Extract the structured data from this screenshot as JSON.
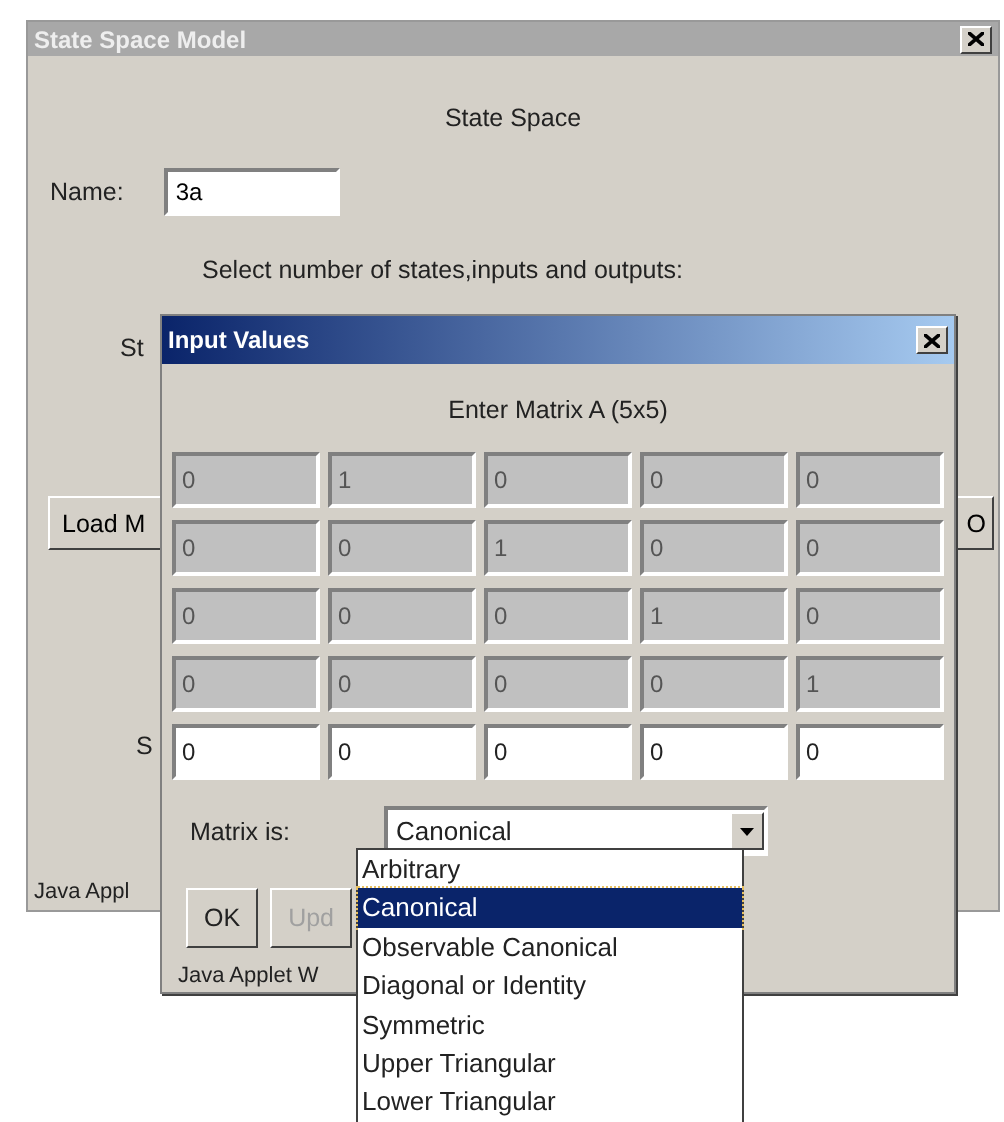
{
  "window": {
    "title": "State Space Model",
    "heading": "State Space",
    "name_label": "Name:",
    "name_value": "3a",
    "prompt": "Select number of states,inputs and outputs:",
    "partial_label_1": "St",
    "load_button": "Load M",
    "right_button": "O",
    "partial_label_2": "S",
    "status": "Java Appl"
  },
  "dialog": {
    "title": "Input Values",
    "heading": "Enter Matrix A (5x5)",
    "rows": [
      {
        "editable": false,
        "cells": [
          "0",
          "1",
          "0",
          "0",
          "0"
        ]
      },
      {
        "editable": false,
        "cells": [
          "0",
          "0",
          "1",
          "0",
          "0"
        ]
      },
      {
        "editable": false,
        "cells": [
          "0",
          "0",
          "0",
          "1",
          "0"
        ]
      },
      {
        "editable": false,
        "cells": [
          "0",
          "0",
          "0",
          "0",
          "1"
        ]
      },
      {
        "editable": true,
        "cells": [
          "0",
          "0",
          "0",
          "0",
          "0"
        ]
      }
    ],
    "matrix_label": "Matrix is:",
    "matrix_value": "Canonical",
    "buttons": [
      {
        "label": "OK",
        "disabled": false
      },
      {
        "label": "Upd",
        "disabled": true
      }
    ],
    "status": "Java Applet W",
    "options": [
      {
        "label": "Arbitrary",
        "selected": false
      },
      {
        "label": "Canonical",
        "selected": true
      },
      {
        "label": "Observable Canonical",
        "selected": false
      },
      {
        "label": "Diagonal or Identity",
        "selected": false
      },
      {
        "label": "Symmetric",
        "selected": false
      },
      {
        "label": "Upper Triangular",
        "selected": false
      },
      {
        "label": "Lower Triangular",
        "selected": false
      }
    ]
  }
}
